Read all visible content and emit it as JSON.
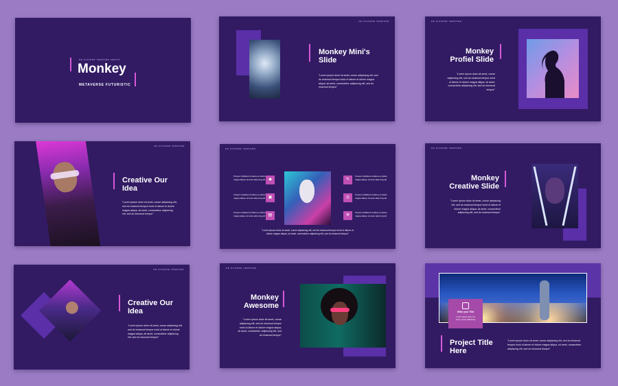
{
  "colors": {
    "background": "#9b7cc4",
    "slide": "#321b63",
    "accent": "#d85ad8",
    "panel": "#5a2fa8"
  },
  "s1": {
    "brand": "DE DIVARNE TEMPORE IMECIO",
    "title": "Monkey",
    "subtitle": "METAVERSE FUTURISTIC"
  },
  "s2": {
    "brand": "DE DIVARNE TEMPORE",
    "title": "Monkey Mini's Slide",
    "body": "\"Lorem ipsum dolor sit amet, conse adipiscing elit, sed do eiusmod tempor incid ut labore et dolore magna aliqua, sit amet, consectetur adipiscing elit, sed do eiusmod tempor\""
  },
  "s3": {
    "brand": "DE DIVARNE TEMPORE",
    "title": "Monkey Profiel Slide",
    "body": "\"Lorem ipsum dolor sit amet, conse adipiscing elit, sed do eiusmod tempor incid ut labore et dolore magna aliqua, sit amet, consectetur adipiscing elit, sed do eiusmod tempor\""
  },
  "s4": {
    "brand": "DE DIVARNE TEMPORE",
    "title": "Creative Our Idea",
    "body": "\"Lorem ipsum dolor sit amet, conse adipiscing elit, sed do eiusmod tempor incid ut labore et dolore magna aliqua, sit amet, consectetur adipiscing elit, sed do eiusmod tempor\""
  },
  "s5": {
    "brand": "DE DIVARNE TEMPORE",
    "item": "Tempor incididunt ut labore et dolore magna aliqua, sit amet adip cing elit",
    "quote": "\"Lorem ipsum dolor sit amet, conse adipiscing elit, sed do eiusmod tempor incid ut labore et dolore magna aliqua, sit amet, consectetur adipiscing elit, sed do eiusmod tempor\""
  },
  "s6": {
    "brand": "DE DIVARNE TEMPORE",
    "title": "Monkey Creative Slide",
    "body": "\"Lorem ipsum dolor sit amet, conse adipiscing elit, sed do eiusmod tempor incid ut labore et dolore magna aliqua, sit amet, consectetur adipiscing elit, sed do eiusmod tempor\""
  },
  "s7": {
    "brand": "DE DIVARNE TEMPORE",
    "title": "Creative Our Idea",
    "body": "\"Lorem ipsum dolor sit amet, conse adipiscing elit, sed do eiusmod tempor incid ut labore et dolore magna aliqua, sit amet, consectetur adipiscing elit, sed do eiusmod tempor\""
  },
  "s8": {
    "brand": "DE DIVARNE TEMPORE",
    "title": "Monkey Awesome",
    "body": "\"Lorem ipsum dolor sit amet, conse adipiscing elit, sed do eiusmod tempor incid ut labore et dolore magna aliqua, sit amet, consectetur adipiscing elit, sed do eiusmod tempor\""
  },
  "s9": {
    "card_title": "Write your Title",
    "card_body": "Lorem ipsum dolor sit amet, conse adipiscing",
    "title": "Project Title Here",
    "body": "\"Lorem ipsum dolor sit amet, conse adipiscing elit, sed do eiusmod tempor incid ut labore et dolore magna aliqua, sit amet, consectetur adipiscing elit, sed do eiusmod tempor\""
  },
  "icons": [
    "diamond-icon",
    "image-icon",
    "document-icon",
    "pen-icon",
    "target-icon",
    "gear-icon"
  ]
}
